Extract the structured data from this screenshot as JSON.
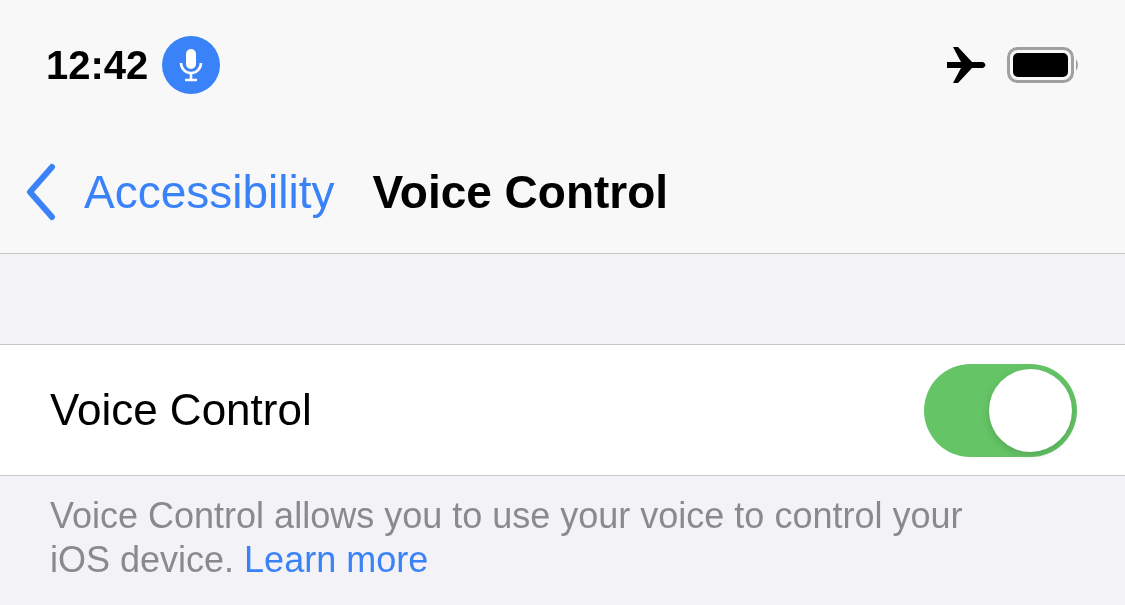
{
  "status_bar": {
    "time": "12:42",
    "mic_active": true
  },
  "nav": {
    "back_label": "Accessibility",
    "title": "Voice Control"
  },
  "settings": [
    {
      "kind": "toggle",
      "label": "Voice Control",
      "on": true
    }
  ],
  "footer": {
    "text": "Voice Control allows you to use your voice to control your iOS device.",
    "link": "Learn more"
  }
}
